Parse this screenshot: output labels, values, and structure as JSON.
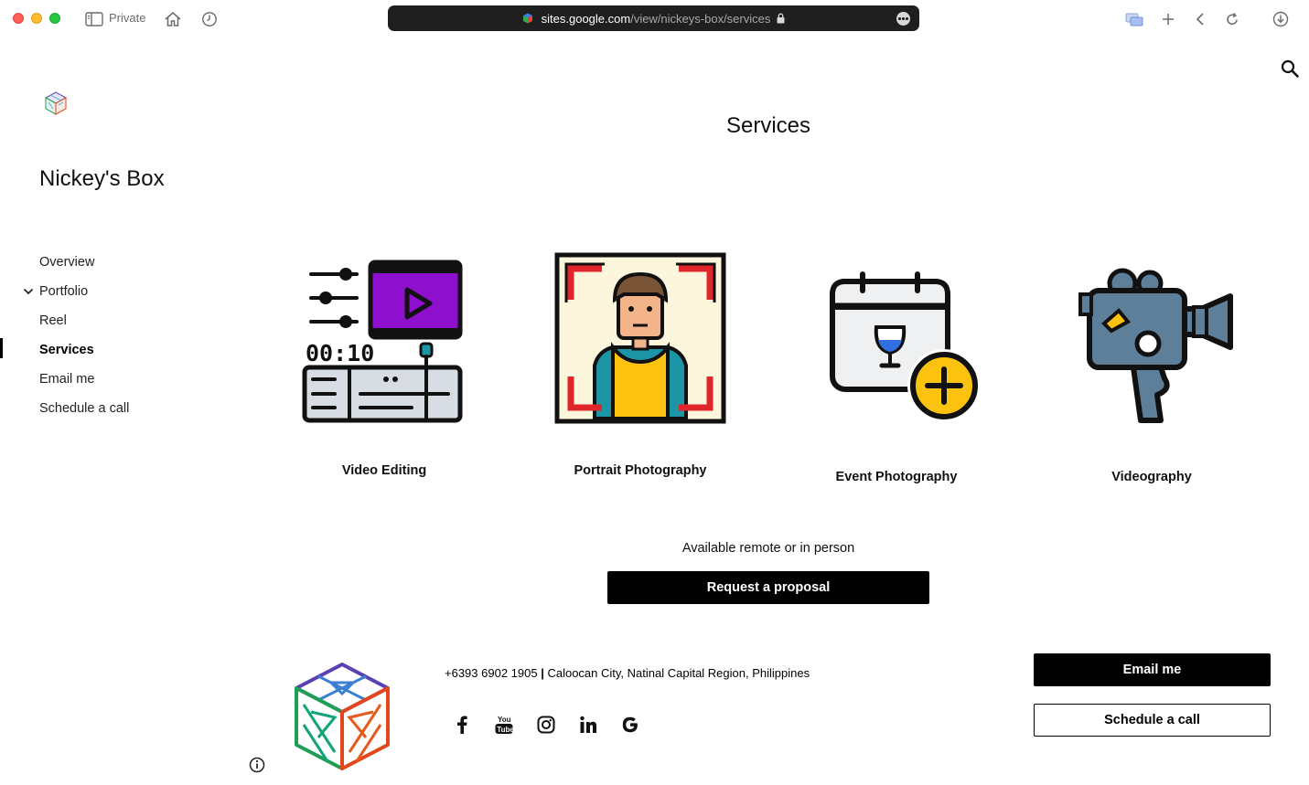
{
  "browser": {
    "private_label": "Private",
    "url_host": "sites.google.com",
    "url_path": "/view/nickeys-box/services",
    "icons": [
      "sidebar-icon",
      "home-icon",
      "history-icon",
      "lock-icon",
      "more-icon",
      "tab-overview-icon",
      "new-tab-icon",
      "back-icon",
      "reload-icon",
      "downloads-icon"
    ]
  },
  "site": {
    "title": "Nickey's Box",
    "search_icon": "search-icon",
    "nav": [
      {
        "label": "Overview",
        "active": false
      },
      {
        "label": "Portfolio",
        "active": false,
        "expandable": true
      },
      {
        "label": "Reel",
        "active": false
      },
      {
        "label": "Services",
        "active": true
      },
      {
        "label": "Email me",
        "active": false
      },
      {
        "label": "Schedule a call",
        "active": false
      }
    ]
  },
  "page": {
    "heading": "Services",
    "services": [
      {
        "label": "Video Editing",
        "icon": "video-editing-icon"
      },
      {
        "label": "Portrait Photography",
        "icon": "portrait-photography-icon"
      },
      {
        "label": "Event Photography",
        "icon": "event-photography-icon"
      },
      {
        "label": "Videography",
        "icon": "video-camera-icon"
      }
    ],
    "availability": "Available remote or in person",
    "proposal_button": "Request a proposal"
  },
  "footer": {
    "phone": "+6393 6902 1905",
    "separator": " | ",
    "location": "Caloocan City, Natinal Capital Region, Philippines",
    "social_icons": [
      "facebook-icon",
      "youtube-icon",
      "instagram-icon",
      "linkedin-icon",
      "google-icon"
    ],
    "email_button": "Email me",
    "call_button": "Schedule a call"
  },
  "colors": {
    "accent": "#000000",
    "purple": "#8f0fcf",
    "red": "#e0262b",
    "yellow": "#fbc20f",
    "teal": "#1c95a6",
    "slate": "#5e7f99"
  }
}
